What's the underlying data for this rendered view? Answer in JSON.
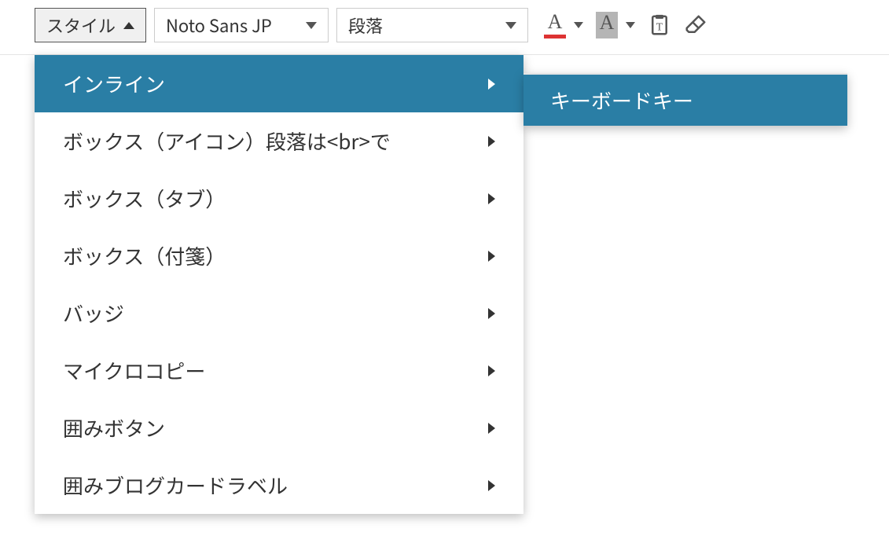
{
  "toolbar": {
    "style_button_label": "スタイル",
    "font_select_value": "Noto Sans JP",
    "format_select_value": "段落"
  },
  "style_menu": {
    "items": [
      {
        "label": "インライン",
        "highlighted": true
      },
      {
        "label": "ボックス（アイコン）段落は<br>で",
        "highlighted": false
      },
      {
        "label": "ボックス（タブ）",
        "highlighted": false
      },
      {
        "label": "ボックス（付箋）",
        "highlighted": false
      },
      {
        "label": "バッジ",
        "highlighted": false
      },
      {
        "label": "マイクロコピー",
        "highlighted": false
      },
      {
        "label": "囲みボタン",
        "highlighted": false
      },
      {
        "label": "囲みブログカードラベル",
        "highlighted": false
      }
    ]
  },
  "submenu": {
    "items": [
      {
        "label": "キーボードキー",
        "highlighted": true
      }
    ]
  }
}
